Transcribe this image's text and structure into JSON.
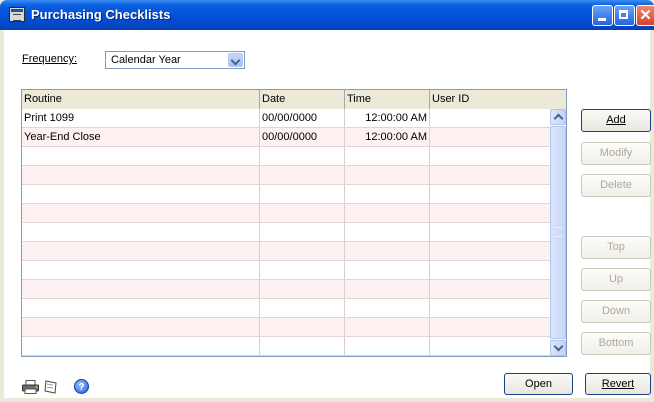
{
  "window": {
    "title": "Purchasing Checklists",
    "close_glyph": "✕"
  },
  "frequency": {
    "label": "Frequency:",
    "value": "Calendar Year"
  },
  "grid": {
    "columns": [
      "Routine",
      "Date",
      "Time",
      "User ID"
    ],
    "rows": [
      {
        "routine": "Print 1099",
        "date": "00/00/0000",
        "time": "12:00:00 AM",
        "user_id": ""
      },
      {
        "routine": "Year-End Close",
        "date": "00/00/0000",
        "time": "12:00:00 AM",
        "user_id": ""
      }
    ],
    "empty_rows": 11
  },
  "side_buttons": {
    "add": {
      "label": "Add",
      "enabled": true
    },
    "modify": {
      "label": "Modify",
      "enabled": false
    },
    "delete": {
      "label": "Delete",
      "enabled": false
    },
    "top": {
      "label": "Top",
      "enabled": false
    },
    "up": {
      "label": "Up",
      "enabled": false
    },
    "down": {
      "label": "Down",
      "enabled": false
    },
    "bottom": {
      "label": "Bottom",
      "enabled": false
    }
  },
  "footer": {
    "open_label": "Open",
    "revert_label": "Revert",
    "icons": [
      "printer-icon",
      "note-icon",
      "help-icon"
    ],
    "help_glyph": "?"
  },
  "colors": {
    "title_bar": "#0451d8",
    "window_bg": "#ece9d8",
    "alt_row": "#fdf1f1",
    "disabled_text": "#aca899"
  }
}
